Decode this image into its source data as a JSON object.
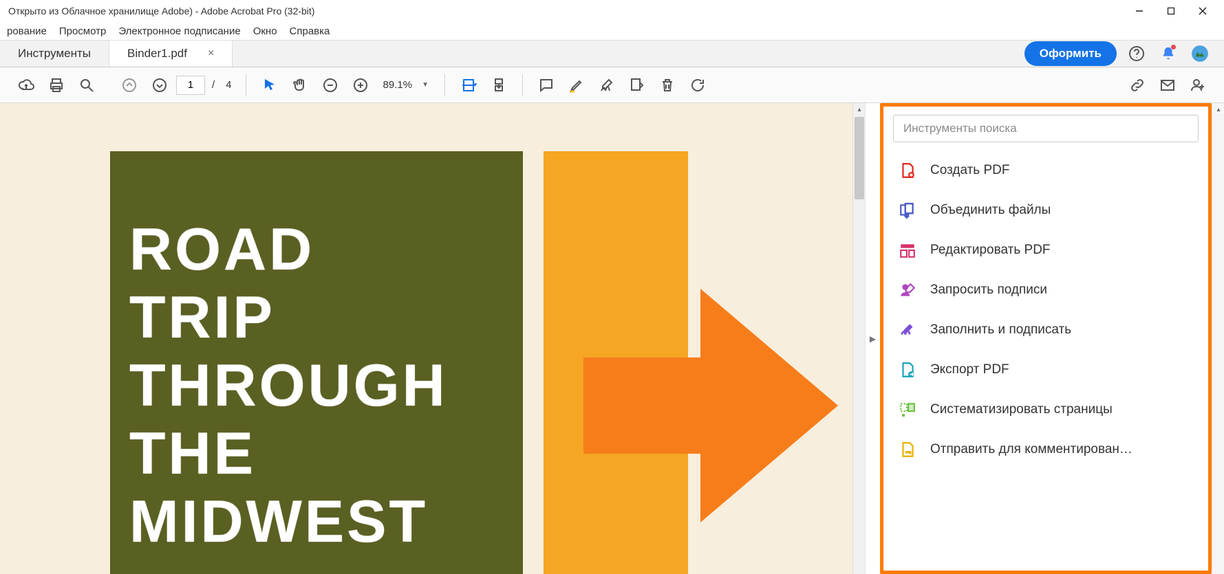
{
  "window": {
    "title": "Открыто из Облачное хранилище Adobe) - Adobe Acrobat Pro (32-bit)"
  },
  "menu": {
    "items": [
      "рование",
      "Просмотр",
      "Электронное подписание",
      "Окно",
      "Справка"
    ]
  },
  "tabs": {
    "tools_label": "Инструменты",
    "doc_label": "Binder1.pdf"
  },
  "header_actions": {
    "subscribe": "Оформить"
  },
  "toolbar": {
    "page_current": "1",
    "page_sep": "/",
    "page_total": "4",
    "zoom": "89.1%"
  },
  "document": {
    "bg_color": "#f7eedd",
    "olive_color": "#5a5f22",
    "orange_color": "#f5a623",
    "arrow_color": "#f77d1a",
    "text": "ROAD\nTRIP\nTHROUGH\nTHE\nMIDWEST"
  },
  "tools_panel": {
    "search_placeholder": "Инструменты поиска",
    "items": [
      {
        "label": "Создать PDF",
        "icon": "create-pdf",
        "color": "#e1251b"
      },
      {
        "label": "Объединить файлы",
        "icon": "combine-files",
        "color": "#4b59c9"
      },
      {
        "label": "Редактировать PDF",
        "icon": "edit-pdf",
        "color": "#d6336c"
      },
      {
        "label": "Запросить подписи",
        "icon": "request-sign",
        "color": "#b046c1"
      },
      {
        "label": "Заполнить и подписать",
        "icon": "fill-sign",
        "color": "#7a4fd6"
      },
      {
        "label": "Экспорт PDF",
        "icon": "export-pdf",
        "color": "#17a2b8"
      },
      {
        "label": "Систематизировать страницы",
        "icon": "organize-pages",
        "color": "#6cbf3f"
      },
      {
        "label": "Отправить для комментирован…",
        "icon": "send-comment",
        "color": "#e8b100"
      }
    ]
  }
}
